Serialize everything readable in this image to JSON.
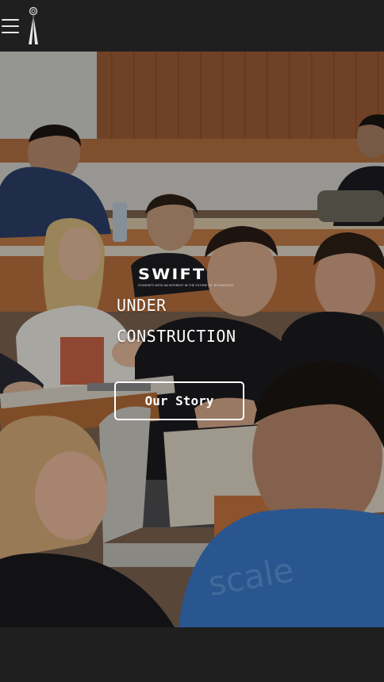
{
  "nav": {
    "menu_icon": "hamburger-menu-icon",
    "logo_icon": "swift-tower-logo-icon"
  },
  "hero": {
    "logo_text": "SWIFT",
    "logo_tagline": "STUDENTS WITH AN INTEREST IN THE FUTURE OF TECHNOLOGY",
    "headline_line1": "UNDER",
    "headline_line2": "CONSTRUCTION",
    "cta_label": "Our Story",
    "background_image": "lecture-hall-audience-photo"
  },
  "colors": {
    "topbar_bg": "#1f1f1f",
    "text": "#ffffff",
    "button_border": "#ffffff"
  }
}
